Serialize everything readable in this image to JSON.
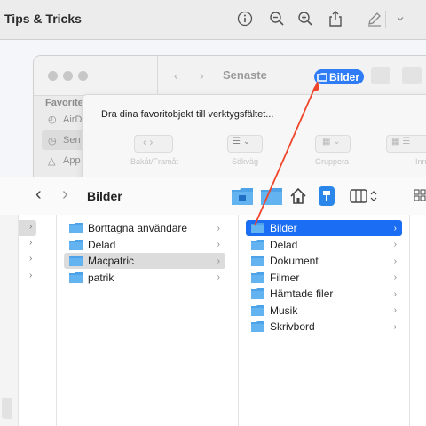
{
  "preview": {
    "title": "Tips & Tricks"
  },
  "background_window": {
    "title": "Senaste",
    "sidebar": {
      "heading": "Favoriter",
      "items": [
        "AirD",
        "Sen",
        "App"
      ]
    },
    "bilder_button": "Bilder"
  },
  "sheet": {
    "message": "Dra dina favoritobjekt till verktygsfältet...",
    "labels": [
      "Bakåt/Framåt",
      "Sökväg",
      "Gruppera",
      "Inn"
    ]
  },
  "finder": {
    "title": "Bilder"
  },
  "column2": {
    "items": [
      {
        "label": "Borttagna användare",
        "selected": false
      },
      {
        "label": "Delad",
        "selected": false
      },
      {
        "label": "Macpatric",
        "selected": true
      },
      {
        "label": "patrik",
        "selected": false
      }
    ]
  },
  "column3": {
    "items": [
      {
        "label": "Bilder",
        "icon": "pictures-folder-icon",
        "selected": true
      },
      {
        "label": "Delad",
        "icon": "folder-icon",
        "selected": false
      },
      {
        "label": "Dokument",
        "icon": "folder-icon",
        "selected": false
      },
      {
        "label": "Filmer",
        "icon": "folder-icon",
        "selected": false
      },
      {
        "label": "Hämtade filer",
        "icon": "folder-icon",
        "selected": false
      },
      {
        "label": "Musik",
        "icon": "folder-icon",
        "selected": false
      },
      {
        "label": "Skrivbord",
        "icon": "folder-icon",
        "selected": false
      }
    ]
  },
  "colors": {
    "accent": "#1b6ef3",
    "arrow": "#f0452b",
    "folder": "#4ea3e8"
  }
}
